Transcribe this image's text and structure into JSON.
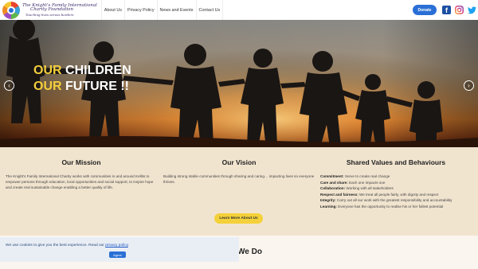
{
  "header": {
    "logo": {
      "line1": "The Knight's Family International",
      "line2": "Charity Foundation",
      "line3": "Touching lives across borders"
    },
    "nav": [
      "About Us",
      "Privacy Policy",
      "News and Events",
      "Contact Us"
    ],
    "donate_label": "Donate",
    "facebook_glyph": "f"
  },
  "hero": {
    "line1_highlight": "OUR",
    "line1_rest": " CHILDREN",
    "line2_highlight": "OUR",
    "line2_rest": " FUTURE !!",
    "prev_glyph": "‹",
    "next_glyph": "›"
  },
  "mission": {
    "title": "Our Mission",
    "text": "The Knight's Family International Charity works with communities in and around Kellits to empower persons through education, local opportunities and social support, to inspire hope and create real sustainable change enabling a better quality of life."
  },
  "vision": {
    "title": "Our Vision",
    "text": "Building strong stable communities through sharing and caring… impacting lives so everyone thrives."
  },
  "values": {
    "title": "Shared Values and Behaviours",
    "items": [
      {
        "label": "Commitment:",
        "text": " Serve to create real change"
      },
      {
        "label": "Care and share:",
        "text": " Each one impacts one"
      },
      {
        "label": "Collaboration:",
        "text": " Working with all stakeholders"
      },
      {
        "label": "Respect and fairness:",
        "text": " We treat all people fairly, with dignity and respect"
      },
      {
        "label": "Integrity:",
        "text": " Carry out all our work with the greatest responsibility and accountability"
      },
      {
        "label": "Learning:",
        "text": " Everyone has the opportunity to realise his or her fullest potential"
      }
    ]
  },
  "learn_more_label": "Learn More About Us",
  "bottom_title": "We Do",
  "cookie": {
    "text": "We use cookies to give you the best experience. Read our ",
    "link": "privacy policy",
    "suffix": ".",
    "agree": "Agree"
  },
  "colors": {
    "accent": "#2a6fd6",
    "highlight": "#f3cf3c",
    "background": "#f1e4cf"
  }
}
